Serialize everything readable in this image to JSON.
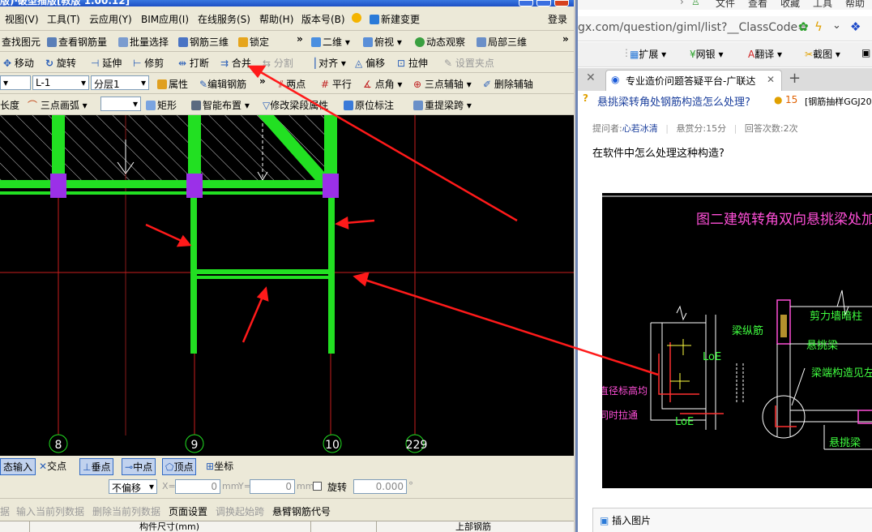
{
  "app": {
    "title_fragment": "版)·破型描版[教版 1.00.12]",
    "login": "登录"
  },
  "menu": [
    "视图(V)",
    "工具(T)",
    "云应用(Y)",
    "BIM应用(I)",
    "在线服务(S)",
    "帮助(H)",
    "版本号(B)",
    "新建变更"
  ],
  "toolbar1": [
    "查找图元",
    "查看钢筋量",
    "批量选择",
    "钢筋三维",
    "锁定",
    "二维",
    "俯视",
    "动态观察",
    "局部三维"
  ],
  "toolbar2": [
    "移动",
    "旋转",
    "延伸",
    "修剪",
    "打断",
    "合并",
    "分割",
    "对齐",
    "偏移",
    "拉伸",
    "设置夹点"
  ],
  "toolbar3": {
    "select1": "L-1",
    "select2": "分层1",
    "items": [
      "属性",
      "编辑钢筋",
      "两点",
      "平行",
      "点角",
      "三点辅轴",
      "删除辅轴"
    ]
  },
  "toolbar4": [
    "长度",
    "三点画弧",
    "矩形",
    "智能布置",
    "修改梁段属性",
    "原位标注",
    "重提梁跨"
  ],
  "axes": [
    "8",
    "9",
    "10",
    "229"
  ],
  "status1": [
    "态输入",
    "交点",
    "垂点",
    "中点",
    "顶点",
    "坐标"
  ],
  "status2": {
    "offset": "不偏移",
    "x_label": "X=",
    "x_value": "0",
    "y_label": "Y=",
    "y_value": "0",
    "unit": "mm",
    "rotate": "旋转",
    "rotate_value": "0.000",
    "degree": "°"
  },
  "bottom_tabs": [
    "据",
    "输入当前列数据",
    "删除当前列数据",
    "页面设置",
    "调换起始跨",
    "悬臂钢筋代号"
  ],
  "grid_headers": [
    "构件尺寸(mm)",
    "上部钢筋"
  ],
  "browser": {
    "menubar": [
      "文件",
      "查看",
      "收藏",
      "工具",
      "帮助"
    ],
    "address": "gx.com/question/giml/list?__ClassCode=",
    "ext": [
      "扩展",
      "网银",
      "翻译",
      "截图"
    ],
    "tab_title": "专业造价问题答疑平台-广联达",
    "new_tab": "+",
    "question_title": "悬挑梁转角处钢筋构造怎么处理?",
    "score_badge": "15",
    "tag": "[钢筋抽样GGJ20",
    "asker_label": "提问者:",
    "asker": "心若冰清",
    "reward": "悬赏分:15分",
    "answers": "回答次数:2次",
    "question_body": "在软件中怎么处理这种构造?",
    "insert_image": "插入图片"
  },
  "cad_image": {
    "title": "图二建筑转角双向悬挑梁处加强措施",
    "labels": [
      "梁纵筋",
      "LoE",
      "LoE",
      "剪力墙暗柱",
      "悬挑梁",
      "梁端构造见左图",
      "直径标高均",
      "同时拉通",
      "悬挑梁"
    ]
  },
  "colors": {
    "beam": "#22e022",
    "column": "#9b30e8",
    "arrow": "#ff1a1a",
    "axis": "#c81e1e",
    "cad_text": "#ff4fd8",
    "link": "#1a3e9c"
  }
}
